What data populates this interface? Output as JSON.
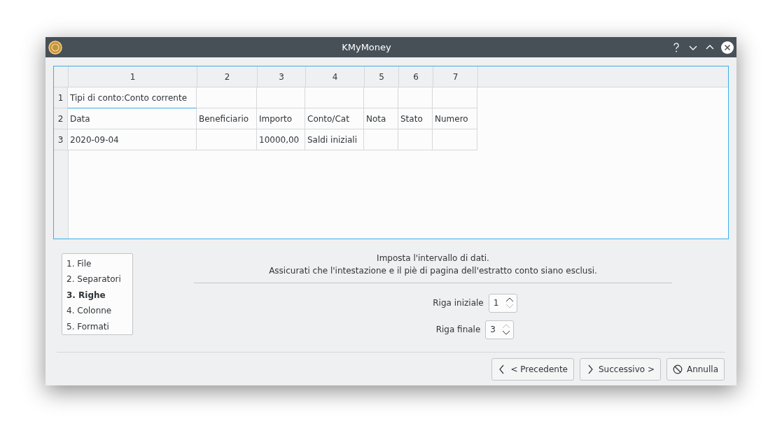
{
  "window": {
    "title": "KMyMoney"
  },
  "table": {
    "columns": [
      "1",
      "2",
      "3",
      "4",
      "5",
      "6",
      "7"
    ],
    "rows": [
      {
        "label": "1",
        "cells": [
          {
            "text": "Tipi di conto:Conto corrente",
            "selected": true
          },
          {
            "selected": false
          },
          {
            "selected": false
          },
          {
            "selected": false
          },
          {
            "selected": false
          },
          {
            "selected": false
          },
          {
            "selected": false
          }
        ]
      },
      {
        "label": "2",
        "cells": [
          {
            "text": "Data",
            "selected": false
          },
          {
            "text": "Beneficiario",
            "selected": false
          },
          {
            "text": "Importo",
            "selected": false
          },
          {
            "text": "Conto/Cat",
            "selected": false
          },
          {
            "text": "Nota",
            "selected": false
          },
          {
            "text": "Stato",
            "selected": false
          },
          {
            "text": "Numero",
            "selected": false
          }
        ]
      },
      {
        "label": "3",
        "cells": [
          {
            "text": "2020-09-04",
            "selected": false
          },
          {
            "selected": false
          },
          {
            "text": "10000,00",
            "selected": false
          },
          {
            "text": "Saldi iniziali",
            "selected": false
          },
          {
            "selected": false
          },
          {
            "selected": false
          },
          {
            "selected": false
          }
        ]
      }
    ]
  },
  "steps": [
    {
      "label": "1. File",
      "selected": false
    },
    {
      "label": "2. Separatori",
      "selected": false
    },
    {
      "label": "3. Righe",
      "selected": true
    },
    {
      "label": "4. Colonne",
      "selected": false
    },
    {
      "label": "5. Formati",
      "selected": false
    }
  ],
  "instructions": [
    "Imposta l'intervallo di dati.",
    "Assicurati che l'intestazione e il piè di pagina dell'estratto conto siano esclusi."
  ],
  "fields": [
    {
      "label": "Riga iniziale",
      "value": "1",
      "up_disabled": false,
      "down_disabled": true
    },
    {
      "label": "Riga finale",
      "value": "3",
      "up_disabled": true,
      "down_disabled": false
    }
  ],
  "buttons": [
    {
      "kind": "prev",
      "label": "< Precedente"
    },
    {
      "kind": "next",
      "label": "Successivo >"
    },
    {
      "kind": "cancel",
      "label": "Annulla"
    }
  ]
}
